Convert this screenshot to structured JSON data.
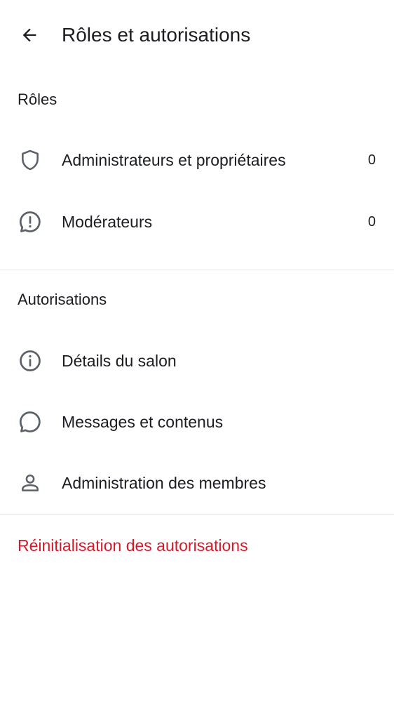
{
  "header": {
    "title": "Rôles et autorisations",
    "back_icon": "arrow-left-icon"
  },
  "roles": {
    "title": "Rôles",
    "items": [
      {
        "label": "Administrateurs et propriétaires",
        "count": "0",
        "icon": "shield-icon"
      },
      {
        "label": "Modérateurs",
        "count": "0",
        "icon": "alert-chat-icon"
      }
    ]
  },
  "permissions": {
    "title": "Autorisations",
    "items": [
      {
        "label": "Détails du salon",
        "icon": "info-icon"
      },
      {
        "label": "Messages et contenus",
        "icon": "chat-bubble-icon"
      },
      {
        "label": "Administration des membres",
        "icon": "user-icon"
      }
    ]
  },
  "reset": {
    "label": "Réinitialisation des autorisations",
    "color": "#d51928"
  },
  "colors": {
    "text": "#1b1d22",
    "icon": "#5c6169",
    "divider": "#e3e5e8",
    "danger": "#d51928"
  }
}
